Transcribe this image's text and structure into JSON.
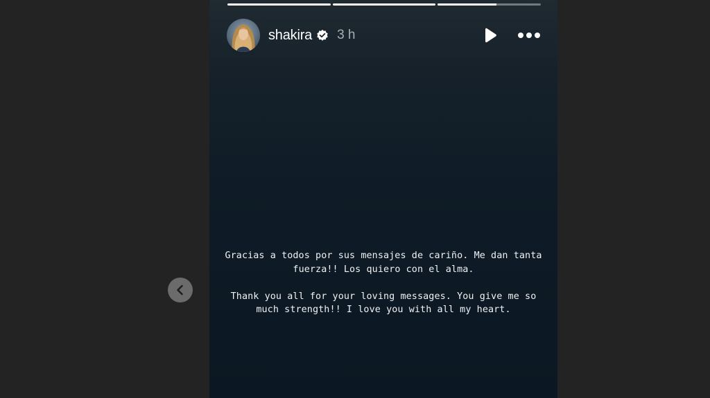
{
  "story": {
    "progress": [
      1.0,
      1.0,
      0.57
    ],
    "user": {
      "username": "shakira",
      "verified": true,
      "time_ago": "3 h"
    },
    "controls": {
      "play_icon": "play-icon",
      "more_icon": "more-options-icon"
    },
    "caption": {
      "spanish": "Gracias a todos por sus mensajes de cariño. Me dan tanta fuerza!! Los quiero con el alma.",
      "english": "Thank you all for your loving messages. You give me so much strength!! I love you with all my heart."
    }
  },
  "navigation": {
    "previous_icon": "chevron-left-icon"
  },
  "colors": {
    "page_background": "#232323",
    "story_background": "#0f1c27",
    "text": "#ffffff",
    "prev_button": "#6b6b6b"
  }
}
